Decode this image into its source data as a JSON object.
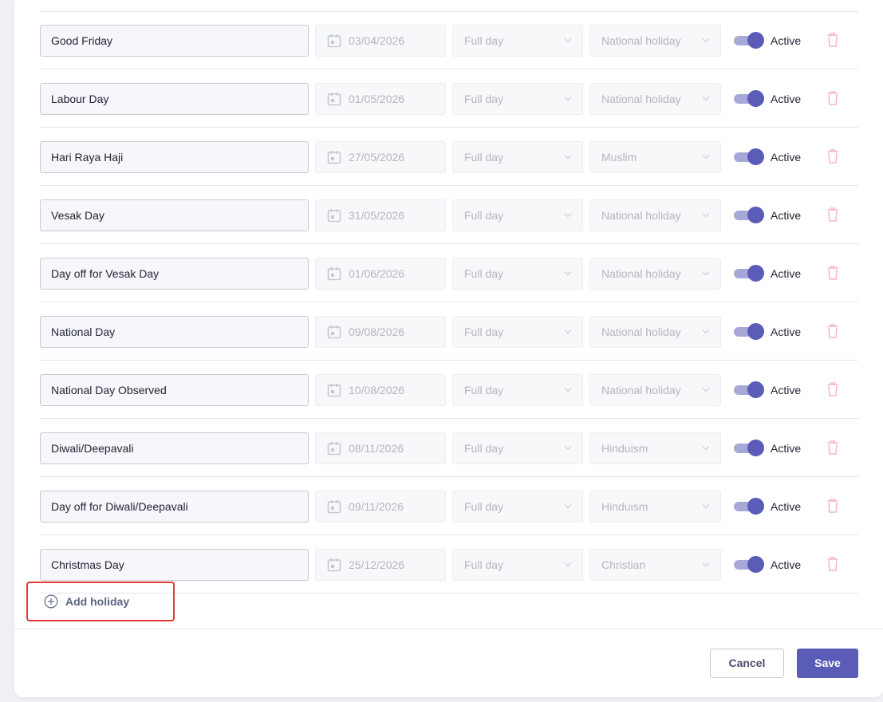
{
  "holidays": [
    {
      "name": "Good Friday",
      "date": "03/04/2026",
      "duration": "Full day",
      "category": "National holiday",
      "status": "Active"
    },
    {
      "name": "Labour Day",
      "date": "01/05/2026",
      "duration": "Full day",
      "category": "National holiday",
      "status": "Active"
    },
    {
      "name": "Hari Raya Haji",
      "date": "27/05/2026",
      "duration": "Full day",
      "category": "Muslim",
      "status": "Active"
    },
    {
      "name": "Vesak Day",
      "date": "31/05/2026",
      "duration": "Full day",
      "category": "National holiday",
      "status": "Active"
    },
    {
      "name": "Day off for Vesak Day",
      "date": "01/06/2026",
      "duration": "Full day",
      "category": "National holiday",
      "status": "Active"
    },
    {
      "name": "National Day",
      "date": "09/08/2026",
      "duration": "Full day",
      "category": "National holiday",
      "status": "Active"
    },
    {
      "name": "National Day Observed",
      "date": "10/08/2026",
      "duration": "Full day",
      "category": "National holiday",
      "status": "Active"
    },
    {
      "name": "Diwali/Deepavali",
      "date": "08/11/2026",
      "duration": "Full day",
      "category": "Hinduism",
      "status": "Active"
    },
    {
      "name": "Day off for Diwali/Deepavali",
      "date": "09/11/2026",
      "duration": "Full day",
      "category": "Hinduism",
      "status": "Active"
    },
    {
      "name": "Christmas Day",
      "date": "25/12/2026",
      "duration": "Full day",
      "category": "Christian",
      "status": "Active"
    }
  ],
  "add_holiday": {
    "label": "Add holiday",
    "icon": "plus-circle-icon"
  },
  "footer": {
    "cancel_label": "Cancel",
    "save_label": "Save"
  },
  "colors": {
    "accent": "#5a5cb8",
    "toggle_track": "#a7a8d8",
    "highlight_border": "#e23a3a",
    "delete_icon": "#f4b8bd"
  }
}
